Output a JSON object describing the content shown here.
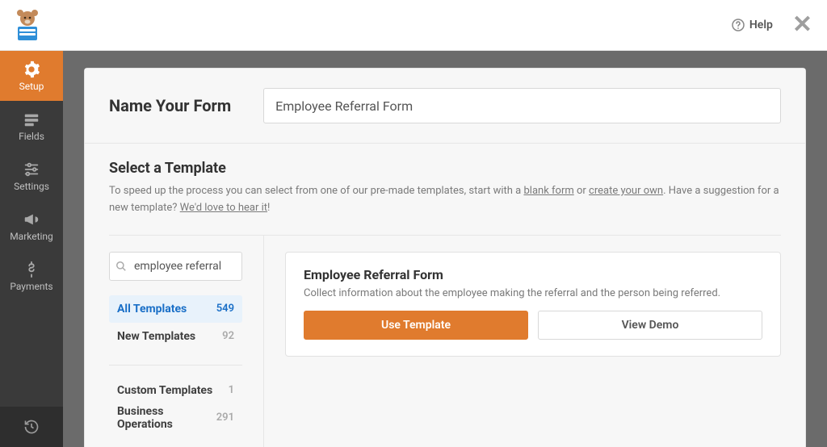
{
  "topbar": {
    "help_label": "Help"
  },
  "sidebar": {
    "items": [
      {
        "label": "Setup"
      },
      {
        "label": "Fields"
      },
      {
        "label": "Settings"
      },
      {
        "label": "Marketing"
      },
      {
        "label": "Payments"
      }
    ]
  },
  "form_name": {
    "label": "Name Your Form",
    "value": "Employee Referral Form"
  },
  "select_template": {
    "title": "Select a Template",
    "desc_1": "To speed up the process you can select from one of our pre-made templates, start with a ",
    "link_blank": "blank form",
    "desc_2": " or ",
    "link_create": "create your own",
    "desc_3": ". Have a suggestion for a new template? ",
    "link_suggest": "We'd love to hear it",
    "desc_4": "!"
  },
  "search": {
    "value": "employee referral"
  },
  "categories": {
    "top": [
      {
        "label": "All Templates",
        "count": "549"
      },
      {
        "label": "New Templates",
        "count": "92"
      }
    ],
    "bottom": [
      {
        "label": "Custom Templates",
        "count": "1"
      },
      {
        "label": "Business Operations",
        "count": "291"
      }
    ]
  },
  "template": {
    "title": "Employee Referral Form",
    "description": "Collect information about the employee making the referral and the person being referred.",
    "use_label": "Use Template",
    "demo_label": "View Demo"
  }
}
